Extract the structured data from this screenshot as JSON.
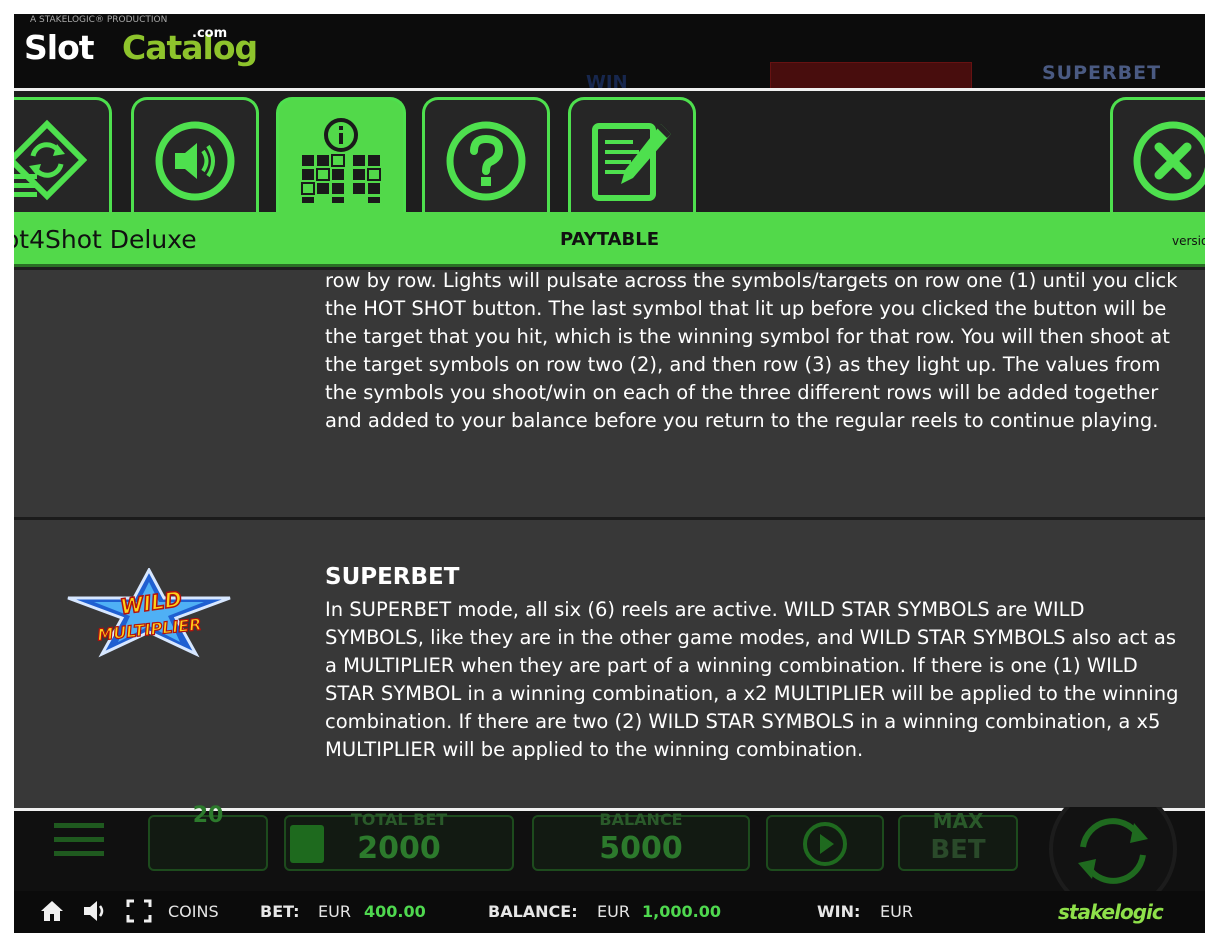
{
  "logo": {
    "tagline": "A STAKELOGIC® PRODUCTION",
    "brand_white": "Slot",
    "brand_green": "Catalog",
    "brand_tld": ".com"
  },
  "game_background": {
    "ghost_win": "WIN",
    "ghost_superbet": "SUPERBET"
  },
  "menu": {
    "tabs": [
      {
        "name": "autoplay",
        "icon": "autoplay-icon",
        "active": false
      },
      {
        "name": "sound",
        "icon": "speaker-icon",
        "active": false
      },
      {
        "name": "paytable",
        "icon": "paytable-info-icon",
        "active": true
      },
      {
        "name": "help",
        "icon": "question-icon",
        "active": false
      },
      {
        "name": "history",
        "icon": "document-pencil-icon",
        "active": false
      },
      {
        "name": "close",
        "icon": "close-icon",
        "active": false
      }
    ],
    "game_name": "ot4Shot Deluxe",
    "section_title": "PAYTABLE",
    "version_label": "versio"
  },
  "content": {
    "hotshot_paragraph": "row by row. Lights will pulsate across the symbols/targets on row one (1) until you click the HOT SHOT button. The last symbol that lit up before you clicked the button will be the target that you hit, which is the winning symbol for that row. You will then shoot at the target symbols on row two (2), and then row (3) as they light up. The values from the symbols you shoot/win on each of the three different rows will be added together and added to your balance before you return to the regular reels to continue playing.",
    "superbet": {
      "title": "SUPERBET",
      "body": "In SUPERBET mode, all six (6) reels are active. WILD STAR SYMBOLS are WILD SYMBOLS, like they are in the other game modes, and WILD STAR SYMBOLS also act as a MULTIPLIER when they are part of a winning combination. If there is one (1) WILD STAR SYMBOL in a winning combination, a x2 MULTIPLIER will be applied to the winning combination. If there are two (2) WILD STAR SYMBOLS in a winning combination, a x5 MULTIPLIER will be applied to the winning combination.",
      "symbol_word1": "WILD",
      "symbol_word2": "MULTIPLIER"
    }
  },
  "controls": {
    "lines_value": "20",
    "total_bet_label": "TOTAL BET",
    "total_bet_value": "2000",
    "balance_label": "BALANCE",
    "balance_value": "5000",
    "max_bet_label": "MAX",
    "max_bet_value": "BET"
  },
  "statusbar": {
    "coins_label": "COINS",
    "bet_label": "BET:",
    "bet_currency": "EUR",
    "bet_value": "400.00",
    "balance_label": "BALANCE:",
    "balance_currency": "EUR",
    "balance_value": "1,000.00",
    "win_label": "WIN:",
    "win_currency": "EUR",
    "provider": "stakelogic"
  },
  "colors": {
    "accent_green": "#52d94a",
    "panel_dark": "#383838",
    "value_green": "#4fd84f"
  }
}
